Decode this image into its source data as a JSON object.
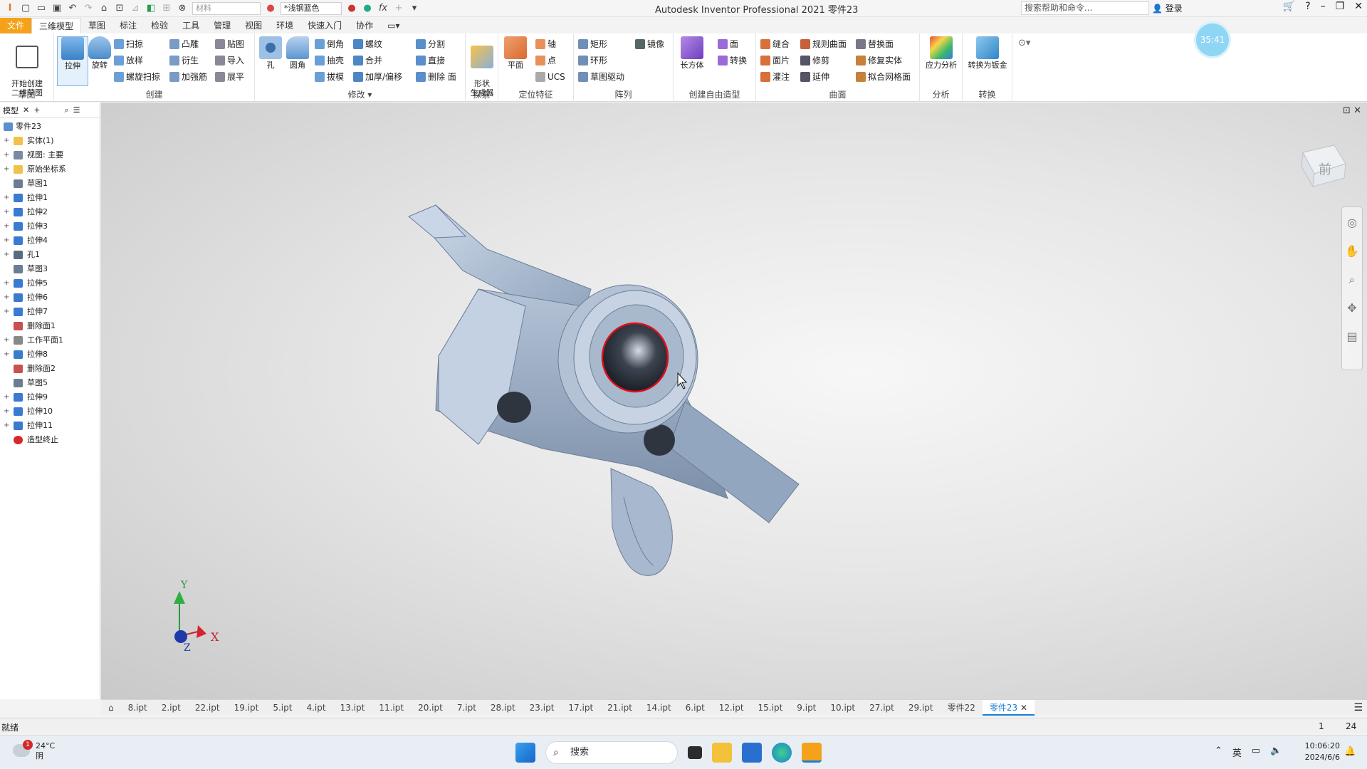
{
  "titlebar": {
    "app_title": "Autodesk Inventor Professional 2021   零件23",
    "material_combo": "材料",
    "appearance_combo": "*浅钢蓝色",
    "help_search": "搜索帮助和命令...",
    "login": "登录"
  },
  "ribbon_tabs": [
    "文件",
    "三维模型",
    "草图",
    "标注",
    "检验",
    "工具",
    "管理",
    "视图",
    "环境",
    "快速入门",
    "协作"
  ],
  "ribbon": {
    "sketch_panel": {
      "label": "草图",
      "start_sketch": "开始创建\n二维草图"
    },
    "create_panel": {
      "label": "创建",
      "extrude": "拉伸",
      "revolve": "旋转",
      "sweep": "扫掠",
      "loft": "放样",
      "coil": "螺旋扫掠",
      "emboss": "凸雕",
      "derive": "衍生",
      "rib": "加强筋",
      "decal": "贴图",
      "import": "导入",
      "unfold": "展平"
    },
    "modify_panel": {
      "label": "修改",
      "hole": "孔",
      "fillet": "圆角",
      "chamfer": "倒角",
      "shell": "抽壳",
      "draft": "拔模",
      "thread": "螺纹",
      "combine": "合并",
      "thicken": "加厚/偏移",
      "split": "分割",
      "direct": "直接",
      "delete_face": "删除 面"
    },
    "explore_panel": {
      "label": "探索",
      "shape_gen": "形状\n生成器"
    },
    "work_panel": {
      "label": "定位特征",
      "plane": "平面",
      "axis": "轴",
      "point": "点",
      "ucs": "UCS"
    },
    "pattern_panel": {
      "label": "阵列",
      "rect": "矩形",
      "circ": "环形",
      "sketch_driven": "草图驱动",
      "mirror": "镜像"
    },
    "freeform_panel": {
      "label": "创建自由造型",
      "box": "长方体",
      "face": "面",
      "convert": "转换"
    },
    "surface_panel": {
      "label": "曲面",
      "stitch": "缝合",
      "patch": "面片",
      "sculpt": "灌注",
      "ruled": "规则曲面",
      "trim": "修剪",
      "extend": "延伸",
      "replace": "替换面",
      "repair": "修复实体",
      "fit_mesh": "拟合网格面"
    },
    "analysis_panel": {
      "label": "分析",
      "stress": "应力分析"
    },
    "convert_panel": {
      "label": "转换",
      "to_sheet": "转换为钣金"
    }
  },
  "clock_bubble": "35:41",
  "browser": {
    "tab_label": "模型",
    "root": "零件23",
    "items": [
      {
        "label": "实体(1)",
        "icon": "folder"
      },
      {
        "label": "视图: 主要",
        "icon": "view"
      },
      {
        "label": "原始坐标系",
        "icon": "folder"
      },
      {
        "label": "草图1",
        "icon": "sketch"
      },
      {
        "label": "拉伸1",
        "icon": "extrude"
      },
      {
        "label": "拉伸2",
        "icon": "extrude"
      },
      {
        "label": "拉伸3",
        "icon": "extrude"
      },
      {
        "label": "拉伸4",
        "icon": "extrude"
      },
      {
        "label": "孔1",
        "icon": "hole"
      },
      {
        "label": "草图3",
        "icon": "sketch"
      },
      {
        "label": "拉伸5",
        "icon": "extrude"
      },
      {
        "label": "拉伸6",
        "icon": "extrude"
      },
      {
        "label": "拉伸7",
        "icon": "extrude"
      },
      {
        "label": "删除面1",
        "icon": "delete"
      },
      {
        "label": "工作平面1",
        "icon": "plane"
      },
      {
        "label": "拉伸8",
        "icon": "extrude"
      },
      {
        "label": "删除面2",
        "icon": "delete"
      },
      {
        "label": "草图5",
        "icon": "sketch"
      },
      {
        "label": "拉伸9",
        "icon": "extrude"
      },
      {
        "label": "拉伸10",
        "icon": "extrude"
      },
      {
        "label": "拉伸11",
        "icon": "extrude"
      },
      {
        "label": "造型终止",
        "icon": "end"
      }
    ]
  },
  "viewport": {
    "viewcube_label": "前",
    "axis_x": "X",
    "axis_y": "Y",
    "axis_z": "Z"
  },
  "doc_tabs": [
    "8.ipt",
    "2.ipt",
    "22.ipt",
    "19.ipt",
    "5.ipt",
    "4.ipt",
    "13.ipt",
    "11.ipt",
    "20.ipt",
    "7.ipt",
    "28.ipt",
    "23.ipt",
    "17.ipt",
    "21.ipt",
    "14.ipt",
    "6.ipt",
    "12.ipt",
    "15.ipt",
    "9.ipt",
    "10.ipt",
    "27.ipt",
    "29.ipt",
    "零件22",
    "零件23"
  ],
  "status": {
    "text": "就绪",
    "n1": "1",
    "n2": "24"
  },
  "taskbar": {
    "weather_temp": "24°C",
    "weather_desc": "阴",
    "weather_badge": "1",
    "search": "搜索",
    "ime": "英",
    "time": "10:06:20",
    "date": "2024/6/6"
  },
  "colors": {
    "file_tab": "#f4a21a",
    "accent": "#1a7fd4",
    "part": "#a9b8cc",
    "highlight": "#e0101e"
  }
}
